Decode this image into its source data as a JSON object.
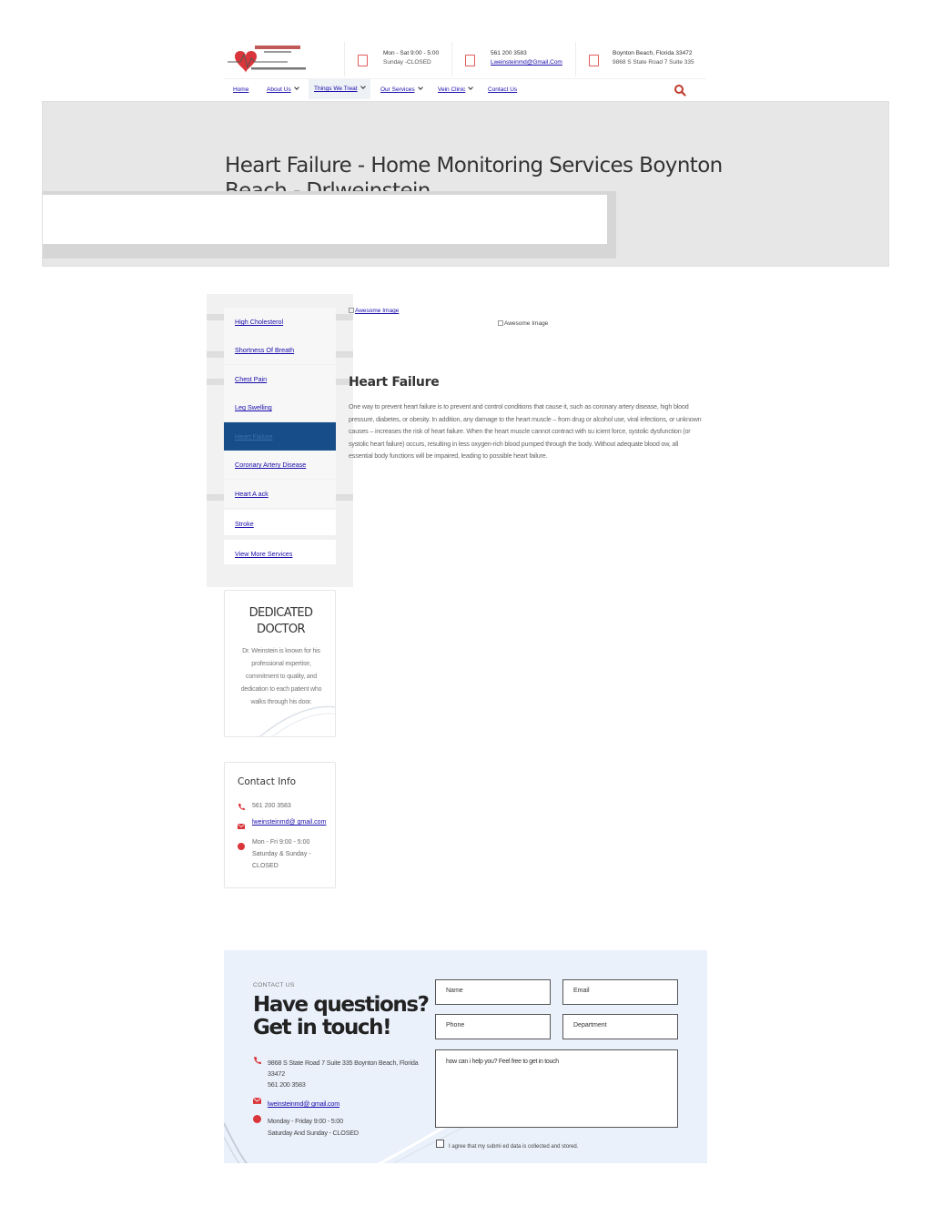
{
  "header": {
    "hours": {
      "line1": "Mon - Sat 9:00 - 5:00",
      "line2": "Sunday -CLOSED"
    },
    "phone_box": {
      "line1": "561 200 3583",
      "line2": "Lweinsteinmd@Gmail.Com"
    },
    "address_box": {
      "line1": "Boynton Beach,  Florida 33472",
      "line2": "9868 S State Road 7 Suite 335"
    },
    "logo_icons": [
      "heart-logo-icon",
      "ecg-line-icon"
    ],
    "accent_color": "#d9353a"
  },
  "nav": {
    "items": [
      {
        "label": "Home",
        "dropdown": false
      },
      {
        "label": "About Us",
        "dropdown": true
      },
      {
        "label": "Things We Treat",
        "dropdown": true
      },
      {
        "label": "Our Services",
        "dropdown": true
      },
      {
        "label": "Vein Clinic",
        "dropdown": true
      },
      {
        "label": "Contact  Us",
        "dropdown": false
      }
    ],
    "search_icon": "search-icon"
  },
  "hero": {
    "title": "Heart Failure - Home Monitoring Services Boynton Beach - Drlweinstein"
  },
  "sidebar": {
    "items": [
      {
        "label": "High Cholesterol"
      },
      {
        "label": "Shortness Of Breath"
      },
      {
        "label": "Chest Pain"
      },
      {
        "label": "Leg Swelling"
      },
      {
        "label": "Heart Failure"
      },
      {
        "label": "Coronary Artery Disease"
      },
      {
        "label": "Heart A   ack"
      },
      {
        "label": "Stroke"
      },
      {
        "label": "View More Services"
      }
    ],
    "active_color": "#174e8a"
  },
  "main": {
    "image1_alt": "Awesome  Image",
    "image2_alt": "Awesome  Image",
    "heading": "Heart Failure",
    "body": "One way to prevent heart failure is to prevent and control conditions that cause it,  such as coronary artery disease, high blood pressure,  diabetes,  or obesity.  In addition,  any damage to the heart muscle – from drug or alcohol use, viral infections,  or unknown causes – increases the risk of heart failure. When the heart muscle cannot contract with su    icient force,  systolic dysfunction (or systolic heart failure) occurs,  resulting in less oxygen-rich blood pumped through the body. Without adequate blood     ow,  all essential body functions will be impaired, leading to possible heart failure."
  },
  "doctor_card": {
    "title": "DEDICATED DOCTOR",
    "text": "Dr. Weinstein is known for his professional  expertise, commitment to quality,  and dedication to each patient who walks through his door."
  },
  "contact_info": {
    "title": "Contact Info",
    "phone": "561 200 3583",
    "email": "lweinsteinmd@ gmail.com",
    "hours": "Mon - Fri 9:00 - 5:00 Saturday & Sunday - CLOSED"
  },
  "contact_section": {
    "label": "CONTACT US",
    "heading": "Have questions? Get in touch!",
    "address": "9868 S State Road 7 Suite 335 Boynton Beach, Florida 33472",
    "phone": "561 200 3583",
    "email": "lweinsteinmd@ gmail.com",
    "hours_line1": "Monday - Friday 9:00 - 5:00",
    "hours_line2": "Saturday And Sunday - CLOSED",
    "form": {
      "name": "Name",
      "email": "Email",
      "phone": "Phone",
      "department": "Department",
      "message": "how can i help you? Feel free to get in touch",
      "agree": "I agree  that  my submi     ed data is collected and stored."
    },
    "background_color": "#eaf1fb"
  }
}
